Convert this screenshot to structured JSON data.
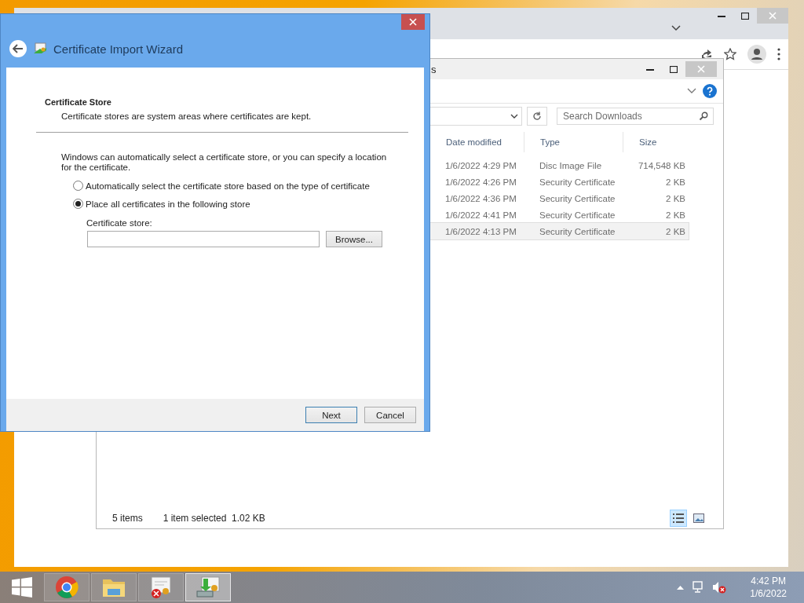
{
  "explorer": {
    "title_fragment": "s",
    "search": {
      "placeholder": "Search Downloads"
    },
    "columns": [
      "Date modified",
      "Type",
      "Size"
    ],
    "rows": [
      {
        "date": "1/6/2022 4:29 PM",
        "type": "Disc Image File",
        "size": "714,548 KB",
        "selected": false
      },
      {
        "date": "1/6/2022 4:26 PM",
        "type": "Security Certificate",
        "size": "2 KB",
        "selected": false
      },
      {
        "date": "1/6/2022 4:36 PM",
        "type": "Security Certificate",
        "size": "2 KB",
        "selected": false
      },
      {
        "date": "1/6/2022 4:41 PM",
        "type": "Security Certificate",
        "size": "2 KB",
        "selected": false
      },
      {
        "date": "1/6/2022 4:13 PM",
        "type": "Security Certificate",
        "size": "2 KB",
        "selected": true
      }
    ],
    "status": {
      "count": "5 items",
      "selection": "1 item selected  1.02 KB"
    },
    "views": [
      {
        "kind": "details",
        "selected": true
      },
      {
        "kind": "thumbnails",
        "selected": false
      }
    ]
  },
  "wizard": {
    "title": "Certificate Import Wizard",
    "heading": "Certificate Store",
    "subheading": "Certificate stores are system areas where certificates are kept.",
    "description": "Windows can automatically select a certificate store, or you can specify a location for the certificate.",
    "options": [
      {
        "label": "Automatically select the certificate store based on the type of certificate",
        "selected": false
      },
      {
        "label": "Place all certificates in the following store",
        "selected": true
      }
    ],
    "store_label": "Certificate store:",
    "browse": "Browse...",
    "buttons": [
      "Next",
      "Cancel"
    ]
  },
  "taskbar": {
    "apps": [
      {
        "kind": "chrome",
        "active": false
      },
      {
        "kind": "folder",
        "active": false
      },
      {
        "kind": "certificate-error",
        "active": false
      },
      {
        "kind": "certificate-install",
        "active": true
      }
    ],
    "clock": {
      "time": "4:42 PM",
      "date": "1/6/2022"
    }
  }
}
